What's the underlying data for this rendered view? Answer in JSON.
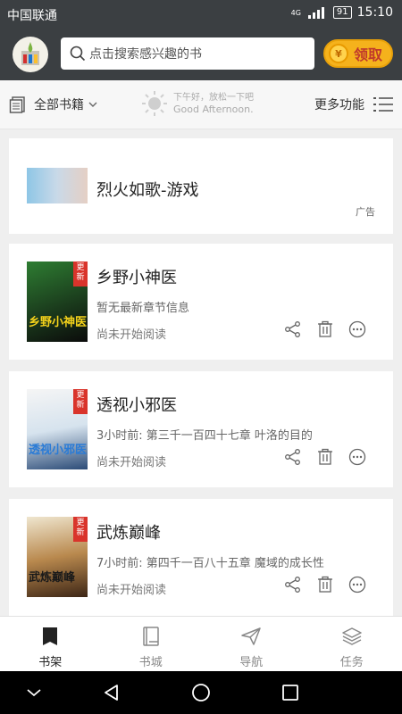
{
  "status_bar": {
    "carrier": "中国联通",
    "network": "4G",
    "battery": "91",
    "time": "15:10"
  },
  "header": {
    "search_placeholder": "点击搜索感兴趣的书",
    "claim_label": "领取",
    "coin_text": "¥"
  },
  "toolbar": {
    "all_books_label": "全部书籍",
    "greeting_line1": "下午好，放松一下吧",
    "greeting_line2": "Good Afternoon.",
    "more_label": "更多功能"
  },
  "ad": {
    "title": "烈火如歌-游戏",
    "tag": "广告"
  },
  "books": [
    {
      "title": "乡野小神医",
      "subtitle": "暂无最新章节信息",
      "status": "尚未开始阅读",
      "cover_title": "乡野小神医",
      "ribbon": "更新"
    },
    {
      "title": "透视小邪医",
      "subtitle": "3小时前: 第三千一百四十七章 叶洛的目的",
      "status": "尚未开始阅读",
      "cover_title": "透视小邪医",
      "ribbon": "更新"
    },
    {
      "title": "武炼巅峰",
      "subtitle": "7小时前: 第四千一百八十五章 魔域的成长性",
      "status": "尚未开始阅读",
      "cover_title": "武炼巅峰",
      "ribbon": "更新"
    }
  ],
  "bottom_nav": [
    {
      "label": "书架",
      "icon": "bookshelf-icon",
      "active": true
    },
    {
      "label": "书城",
      "icon": "bookstore-icon",
      "active": false
    },
    {
      "label": "导航",
      "icon": "navigation-icon",
      "active": false
    },
    {
      "label": "任务",
      "icon": "tasks-icon",
      "active": false
    }
  ],
  "colors": {
    "header_bg": "#3b3f42",
    "accent": "#f5b21c",
    "ribbon": "#d9342b"
  }
}
